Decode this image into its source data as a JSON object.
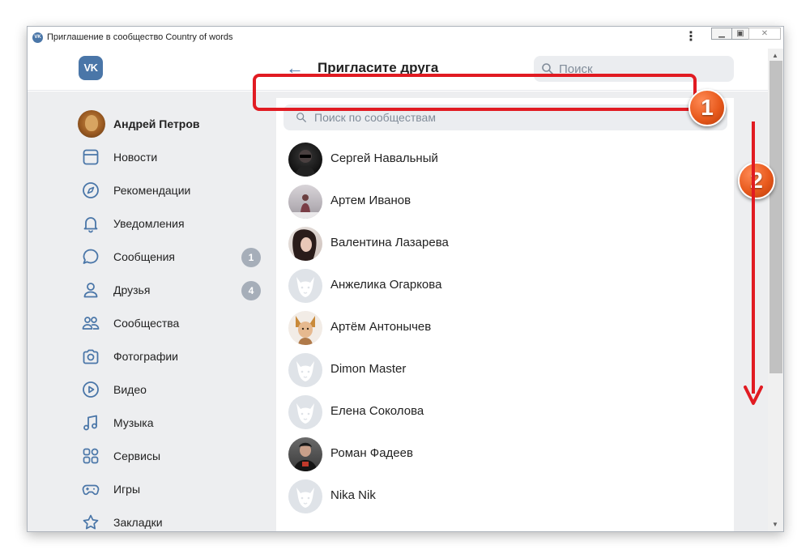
{
  "window": {
    "title": "Приглашение в сообщество Country of words"
  },
  "header": {
    "logo_text": "VK",
    "title": "Пригласите друга",
    "search_placeholder": "Поиск"
  },
  "sidebar": {
    "user": {
      "label": "Андрей Петров"
    },
    "items": [
      {
        "label": "Новости",
        "icon": "newspaper-icon"
      },
      {
        "label": "Рекомендации",
        "icon": "compass-icon"
      },
      {
        "label": "Уведомления",
        "icon": "bell-icon"
      },
      {
        "label": "Сообщения",
        "icon": "chat-bubble-icon",
        "badge": "1"
      },
      {
        "label": "Друзья",
        "icon": "person-icon",
        "badge": "4"
      },
      {
        "label": "Сообщества",
        "icon": "group-icon"
      },
      {
        "label": "Фотографии",
        "icon": "camera-icon"
      },
      {
        "label": "Видео",
        "icon": "play-icon"
      },
      {
        "label": "Музыка",
        "icon": "music-note-icon"
      },
      {
        "label": "Сервисы",
        "icon": "grid-icon"
      },
      {
        "label": "Игры",
        "icon": "gamepad-icon"
      },
      {
        "label": "Закладки",
        "icon": "star-icon"
      }
    ]
  },
  "main": {
    "community_search_placeholder": "Поиск по сообществам",
    "friends": [
      {
        "name": "Сергей Навальный",
        "avatar": "photo"
      },
      {
        "name": "Артем Иванов",
        "avatar": "photo"
      },
      {
        "name": "Валентина Лазарева",
        "avatar": "photo"
      },
      {
        "name": "Анжелика Огаркова",
        "avatar": "default"
      },
      {
        "name": "Артём Антонычев",
        "avatar": "photo"
      },
      {
        "name": "Dimon Master",
        "avatar": "default"
      },
      {
        "name": "Елена Соколова",
        "avatar": "default"
      },
      {
        "name": "Роман Фадеев",
        "avatar": "photo"
      },
      {
        "name": "Nika Nik",
        "avatar": "default"
      }
    ]
  },
  "annotations": {
    "step1": "1",
    "step2": "2",
    "color": "#e11b22"
  },
  "colors": {
    "accent": "#4a76a8",
    "background": "#edeef0",
    "badge": "#a6aeb9"
  }
}
